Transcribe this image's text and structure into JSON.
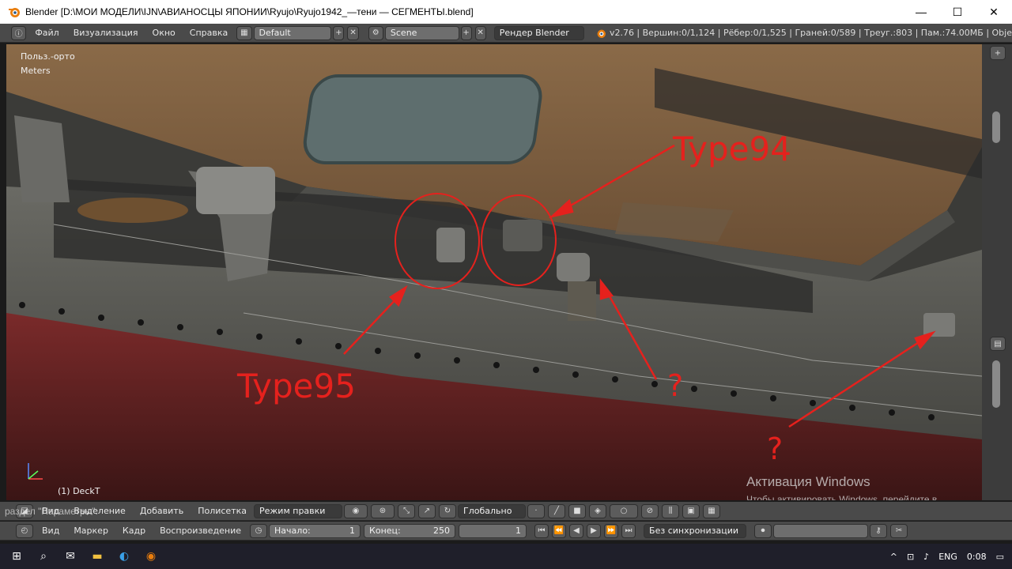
{
  "window": {
    "title": "Blender [D:\\МОИ МОДЕЛИ\\IJN\\АВИАНОСЦЫ ЯПОНИИ\\Ryujo\\Ryujo1942_—тени — СЕГМЕНТЫ.blend]",
    "minimize": "—",
    "maximize": "☐",
    "close": "✕"
  },
  "topbar": {
    "menus": [
      "Файл",
      "Визуализация",
      "Окно",
      "Справка"
    ],
    "screen_layout": "Default",
    "scene": "Scene",
    "render_engine": "Рендер Blender",
    "stats": "v2.76 | Вершин:0/1,124 | Рёбер:0/1,525 | Граней:0/589 | Треуг.:803 | Пам.:74.00МБ | Obje"
  },
  "viewport": {
    "view_name": "Польз.-орто",
    "units": "Meters",
    "object_label": "(1) DeckT",
    "annotations": {
      "type94": "Type94",
      "type95": "Type95",
      "question1": "?",
      "question2": "?"
    },
    "activation_title": "Активация Windows",
    "activation_line1": "Чтобы активировать Windows, перейдите в",
    "activation_line2": "раздел \"Параметры\"."
  },
  "view3d_header": {
    "menus": [
      "Вид",
      "Выделение",
      "Добавить",
      "Полисетка"
    ],
    "mode": "Режим правки",
    "pivot": "Глобально"
  },
  "timeline": {
    "menus": [
      "Вид",
      "Маркер",
      "Кадр",
      "Воспроизведение"
    ],
    "start_label": "Начало:",
    "start_value": "1",
    "end_label": "Конец:",
    "end_value": "250",
    "current_frame": "1",
    "sync": "Без синхронизации"
  },
  "taskbar": {
    "language": "ENG",
    "time": "0:08"
  },
  "colors": {
    "annotation_red": "#e5211d",
    "deck_wood": "#7a5a3a",
    "hull_gray": "#5a5a55",
    "hull_red": "#6b2222"
  }
}
